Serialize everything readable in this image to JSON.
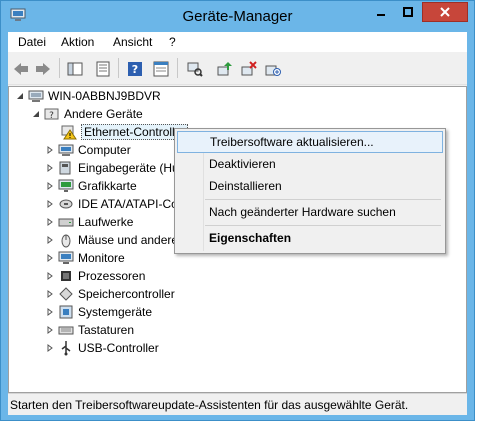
{
  "window": {
    "title": "Geräte-Manager"
  },
  "menu": [
    "Datei",
    "Aktion",
    "Ansicht",
    "?"
  ],
  "toolbar": [
    "back-icon",
    "forward-icon",
    "console-tree-icon",
    "properties-icon",
    "help-icon",
    "console-icon",
    "scan-hardware-icon",
    "update-driver-icon",
    "uninstall-icon",
    "enable-icon"
  ],
  "tree": {
    "root": "WIN-0ABBNJ9BDVR",
    "other_devices": "Andere Geräte",
    "ethernet": "Ethernet-Controller",
    "items": [
      "Computer",
      "Eingabegeräte (Human Interface Devices)",
      "Grafikkarte",
      "IDE ATA/ATAPI-Controller",
      "Laufwerke",
      "Mäuse und andere Zeigegeräte",
      "Monitore",
      "Prozessoren",
      "Speichercontroller",
      "Systemgeräte",
      "Tastaturen",
      "USB-Controller"
    ]
  },
  "context_menu": {
    "update": "Treibersoftware aktualisieren...",
    "disable": "Deaktivieren",
    "uninstall": "Deinstallieren",
    "scan": "Nach geänderter Hardware suchen",
    "properties": "Eigenschaften"
  },
  "status": "Starten den Treibersoftwareupdate-Assistenten für das ausgewählte Gerät."
}
